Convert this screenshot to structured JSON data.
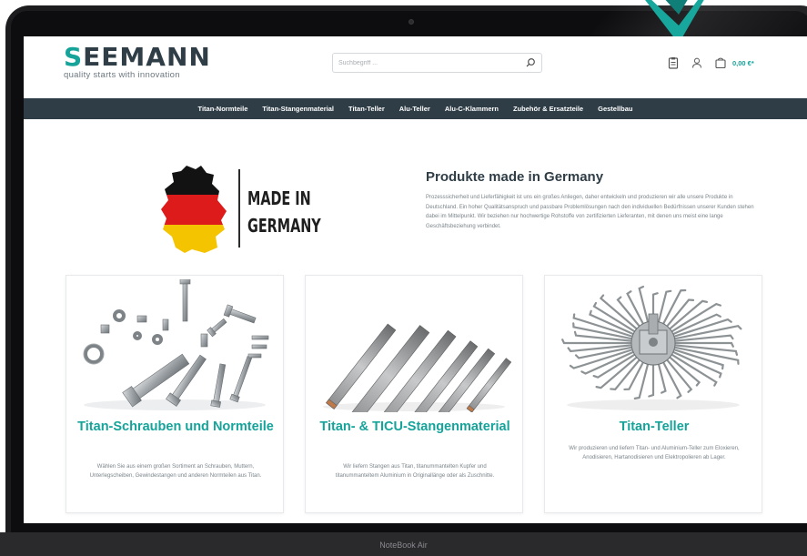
{
  "colors": {
    "teal": "#15a39a",
    "navy": "#2f3d47",
    "text_gray": "#7b848a"
  },
  "logo": {
    "wordmark": "SEEMANN",
    "tagline": "quality starts with innovation"
  },
  "search": {
    "placeholder": "Suchbegriff ..."
  },
  "header_icons": [
    "clipboard-icon",
    "user-icon",
    "cart-icon"
  ],
  "cart": {
    "total": "0,00 €*"
  },
  "nav": {
    "items": [
      "Titan-Normteile",
      "Titan-Stangenmaterial",
      "Titan-Teller",
      "Alu-Teller",
      "Alu-C-Klammern",
      "Zubehör & Ersatzteile",
      "Gestellbau"
    ]
  },
  "made_in": {
    "line1": "MADE IN",
    "line2": "GERMANY"
  },
  "intro": {
    "title": "Produkte made in Germany",
    "text": "Prozesssicherheit und Lieferfähigkeit ist uns ein großes Anliegen, daher entwickeln und produzieren wir alle unsere Produkte in Deutschland. Ein hoher Qualitätsanspruch und passbare Problemlösungen nach den individuellen Bedürfnissen unserer Kunden stehen dabei im Mittelpunkt. Wir beziehen nur hochwertige Rohstoffe von zertifizierten Lieferanten, mit denen uns meist eine lange Geschäftsbeziehung verbindet."
  },
  "cards": [
    {
      "title": "Titan-Schrauben und Normteile",
      "text": "Wählen Sie aus einem großen Sortiment an Schrauben, Muttern, Unterlegscheiben, Gewindestangen und anderen Normteilen aus Titan."
    },
    {
      "title": "Titan- & TICU-Stangenmaterial",
      "text": "Wir liefern Stangen aus Titan, titanummantelten Kupfer und titanummanteltem Aluminium in Originallänge oder als Zuschnitte."
    },
    {
      "title": "Titan-Teller",
      "text": "Wir produzieren und liefern Titan- und Aluminium-Teller zum Eloxieren, Anodisieren, Hartanodisieren und Elektropolieren ab Lager."
    }
  ],
  "device_label": "NoteBook Air"
}
